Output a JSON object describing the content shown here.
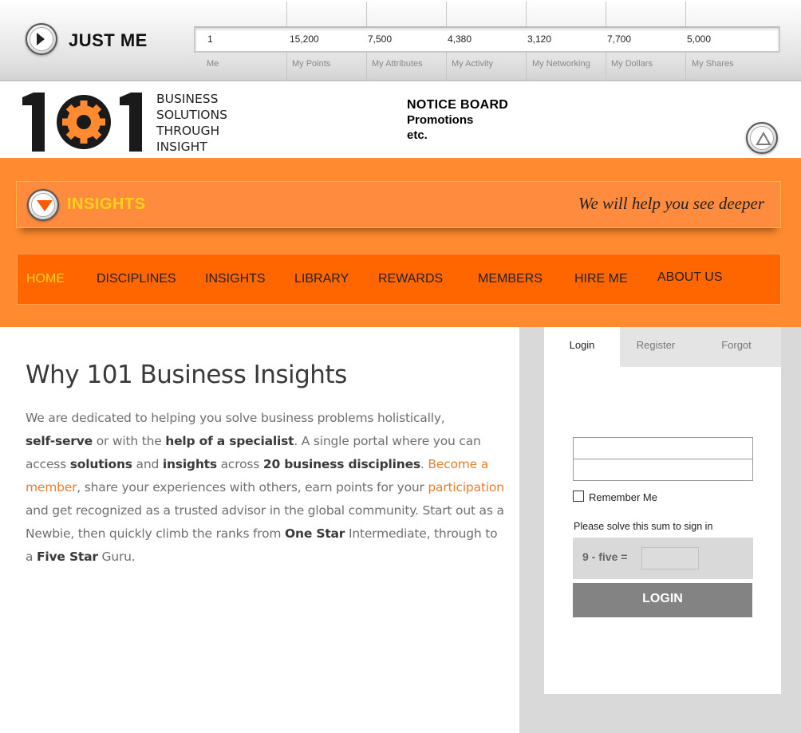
{
  "topbar": {
    "title": "JUST ME",
    "play_icon": "play-icon",
    "stats": [
      {
        "value": "1",
        "label": "Me"
      },
      {
        "value": "15,200",
        "label": "My Points"
      },
      {
        "value": "7,500",
        "label": "My Attributes"
      },
      {
        "value": "4,380",
        "label": "My Activity"
      },
      {
        "value": "3,120",
        "label": "My Networking"
      },
      {
        "value": "7,700",
        "label": "My Dollars"
      },
      {
        "value": "5,000",
        "label": "My Shares"
      }
    ]
  },
  "logo": {
    "text": "101",
    "tagline": [
      "BUSINESS",
      "SOLUTIONS",
      "THROUGH",
      "INSIGHT"
    ]
  },
  "notice": {
    "title": "NOTICE BOARD",
    "lines": [
      "Promotions",
      "etc."
    ]
  },
  "insights_bar": {
    "title": "INSIGHTS",
    "tagline": "We will help you see deeper"
  },
  "nav": {
    "items": [
      "HOME",
      "DISCIPLINES",
      "INSIGHTS",
      "LIBRARY",
      "REWARDS",
      "MEMBERS",
      "HIRE ME",
      "ABOUT US"
    ],
    "active": "HOME"
  },
  "main": {
    "title": "Why 101 Business Insights",
    "p": {
      "t1": "We are dedicated to helping you solve business problems holistically,",
      "b1": "self-serve",
      "t2": " or with the ",
      "b2": "help of a specialist",
      "t3": ". A single portal where you can access ",
      "b3": "solutions",
      "t4": " and ",
      "b4": "insights",
      "t5": " across ",
      "b5": "20 business disciplines",
      "t6": ". ",
      "l1": "Become a member",
      "t7": ", share your experiences with others, earn points for your ",
      "l2": "participation",
      "t8": " and get recognized as a trusted advisor in the global community. Start out as a Newbie, then quickly climb the ranks from ",
      "b6": "One Star",
      "t9": " Intermediate, through to a ",
      "b7": "Five Star",
      "t10": " Guru."
    }
  },
  "login": {
    "tabs": [
      "Login",
      "Register",
      "Forgot"
    ],
    "remember_label": "Remember Me",
    "sum_prompt": "Please solve this sum to sign in",
    "sum_question": "9 - five =",
    "button_label": "LOGIN"
  },
  "colors": {
    "orange_band": "#ff8a2f",
    "nav_bg": "#ff6600",
    "accent_yellow": "#ffd21a",
    "link": "#e97d2c",
    "login_button": "#838383"
  }
}
